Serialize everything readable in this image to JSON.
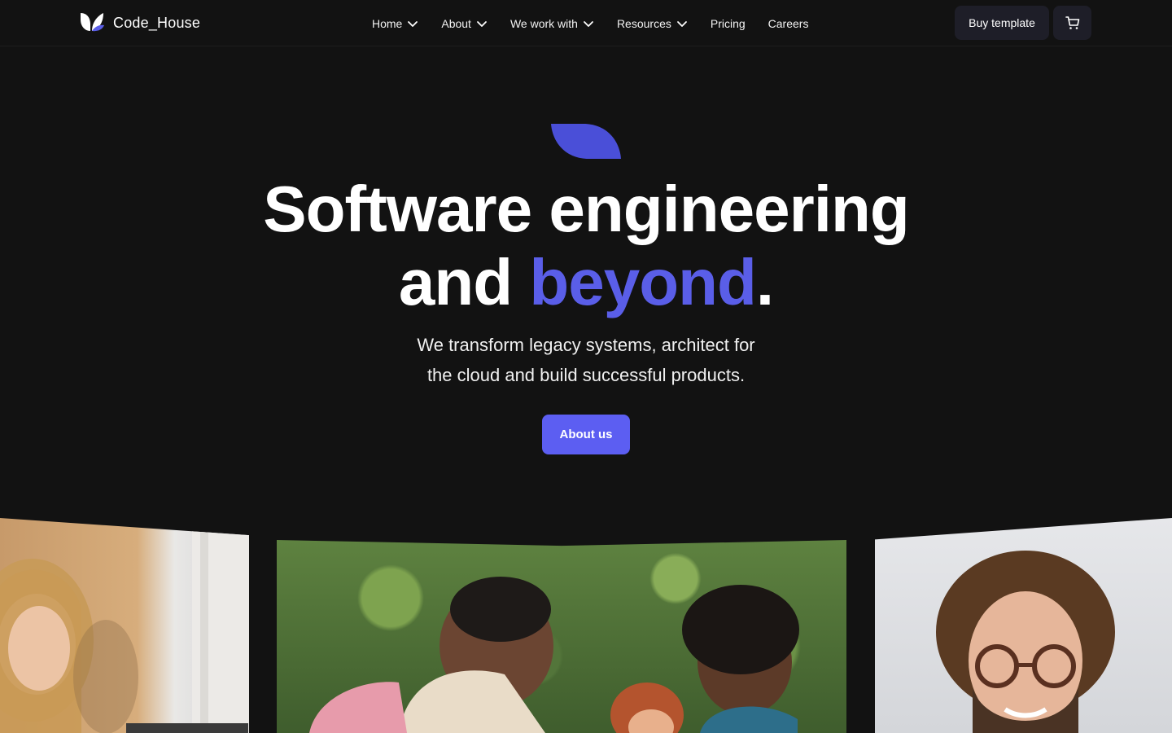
{
  "brand": {
    "name": "Code_House",
    "accent_color": "#5a5ee8"
  },
  "nav": {
    "items": [
      {
        "label": "Home",
        "has_dropdown": true
      },
      {
        "label": "About",
        "has_dropdown": true
      },
      {
        "label": "We work with",
        "has_dropdown": true
      },
      {
        "label": "Resources",
        "has_dropdown": true
      },
      {
        "label": "Pricing",
        "has_dropdown": false
      },
      {
        "label": "Careers",
        "has_dropdown": false
      }
    ],
    "buy_label": "Buy template",
    "cart_icon": "cart-icon"
  },
  "hero": {
    "title_line1": "Software engineering",
    "title_line2_prefix": "and ",
    "title_line2_accent": "beyond",
    "title_line2_suffix": ".",
    "subtitle_line1": "We transform legacy systems, architect for",
    "subtitle_line2": "the cloud and build successful products.",
    "cta_label": "About us"
  }
}
